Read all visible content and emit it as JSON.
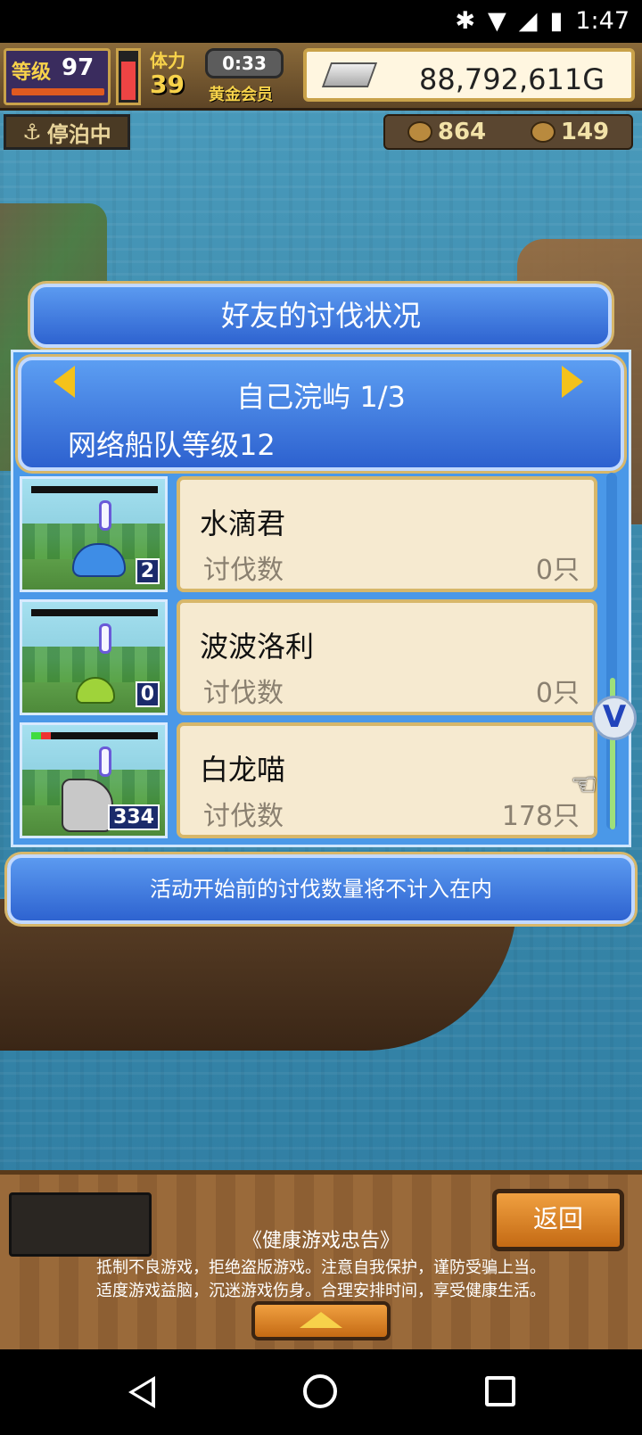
{
  "status_bar": {
    "time": "1:47",
    "icons": [
      "bluetooth-icon",
      "wifi-icon",
      "signal-icon",
      "battery-icon"
    ]
  },
  "hud": {
    "level_label": "等级",
    "level_value": "97",
    "stamina_label": "体力",
    "stamina_value": "39",
    "timer": "0:33",
    "membership": "黄金会员",
    "gold": "88,792,611G",
    "docked_label": "停泊中",
    "resource_1": "864",
    "resource_2": "149"
  },
  "dialog": {
    "title": "好友的讨伐状况",
    "island_name": "自己浣屿 1/3",
    "fleet_level": "网络船队等级12",
    "kill_label": "讨伐数",
    "entries": [
      {
        "name": "水滴君",
        "kills": "0只",
        "count": "2"
      },
      {
        "name": "波波洛利",
        "kills": "0只",
        "count": "0"
      },
      {
        "name": "白龙喵",
        "kills": "178只",
        "count": "334"
      }
    ],
    "notice": "活动开始前的讨伐数量将不计入在内"
  },
  "bottom": {
    "back_label": "返回",
    "advisory_title": "《健康游戏忠告》",
    "advisory_line1": "抵制不良游戏，拒绝盗版游戏。注意自我保护，谨防受骗上当。",
    "advisory_line2": "适度游戏益脑，沉迷游戏伤身。合理安排时间，享受健康生活。"
  },
  "colors": {
    "dialog_blue": "#2e63d0",
    "card_bg": "#f6ead0",
    "gold_trim": "#d7b76a",
    "button_orange": "#c46a14"
  }
}
